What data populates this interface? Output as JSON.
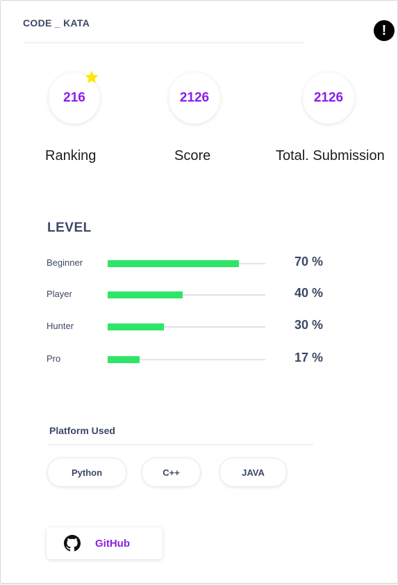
{
  "header": {
    "title": "CODE _ KATA",
    "alert_icon": "exclamation-icon"
  },
  "stats": [
    {
      "value": "216",
      "label": "Ranking"
    },
    {
      "value": "2126",
      "label": "Score"
    },
    {
      "value": "2126",
      "label": "Total. Submission"
    }
  ],
  "ranking_badge_icon": "star-icon",
  "level": {
    "title": "LEVEL",
    "items": [
      {
        "name": "Beginner",
        "percent": 70,
        "percent_label": "70 %"
      },
      {
        "name": "Player",
        "percent": 40,
        "percent_label": "40 %"
      },
      {
        "name": "Hunter",
        "percent": 30,
        "percent_label": "30 %"
      },
      {
        "name": "Pro",
        "percent": 17,
        "percent_label": "17 %"
      }
    ]
  },
  "platforms": {
    "title": "Platform Used",
    "items": [
      "Python",
      "C++",
      "JAVA"
    ]
  },
  "github": {
    "label": "GitHub",
    "icon": "github-icon"
  },
  "colors": {
    "accent": "#8a1ee8",
    "progress": "#2ee568",
    "heading": "#3d4766",
    "star": "#ffe600"
  }
}
